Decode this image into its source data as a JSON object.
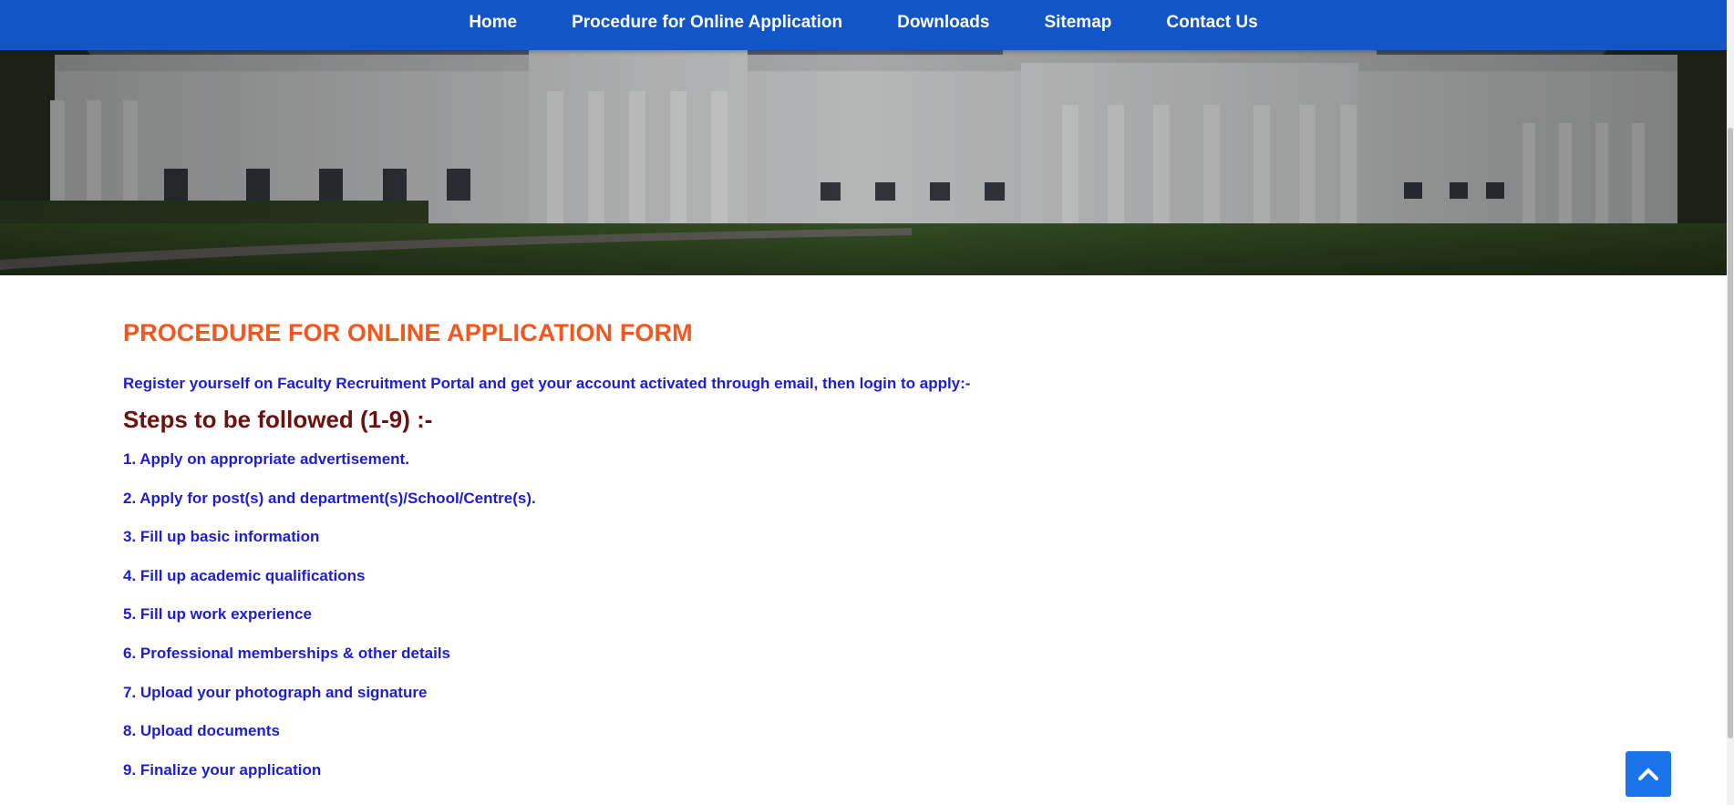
{
  "nav": {
    "items": [
      {
        "label": "Home"
      },
      {
        "label": "Procedure for Online Application"
      },
      {
        "label": "Downloads"
      },
      {
        "label": "Sitemap"
      },
      {
        "label": "Contact Us"
      }
    ]
  },
  "content": {
    "title": "PROCEDURE FOR ONLINE APPLICATION FORM",
    "intro": "Register yourself on Faculty Recruitment Portal and get your account activated through email, then login to apply:-",
    "steps_heading": "Steps to be followed (1-9) :-",
    "steps": [
      "1. Apply on appropriate advertisement.",
      "2. Apply for post(s) and department(s)/School/Centre(s).",
      "3. Fill up basic information",
      "4. Fill up academic qualifications",
      "5. Fill up work experience",
      "6. Professional memberships & other details",
      "7. Upload your photograph and signature",
      "8. Upload documents",
      "9. Finalize your application"
    ]
  },
  "icons": {
    "back_to_top": "chevron-up-icon"
  },
  "colors": {
    "nav_background": "#1155c6",
    "title": "#f4571e",
    "body_text": "#1d1dd6",
    "steps_heading": "#6b1111",
    "back_to_top": "#1a73e8"
  }
}
